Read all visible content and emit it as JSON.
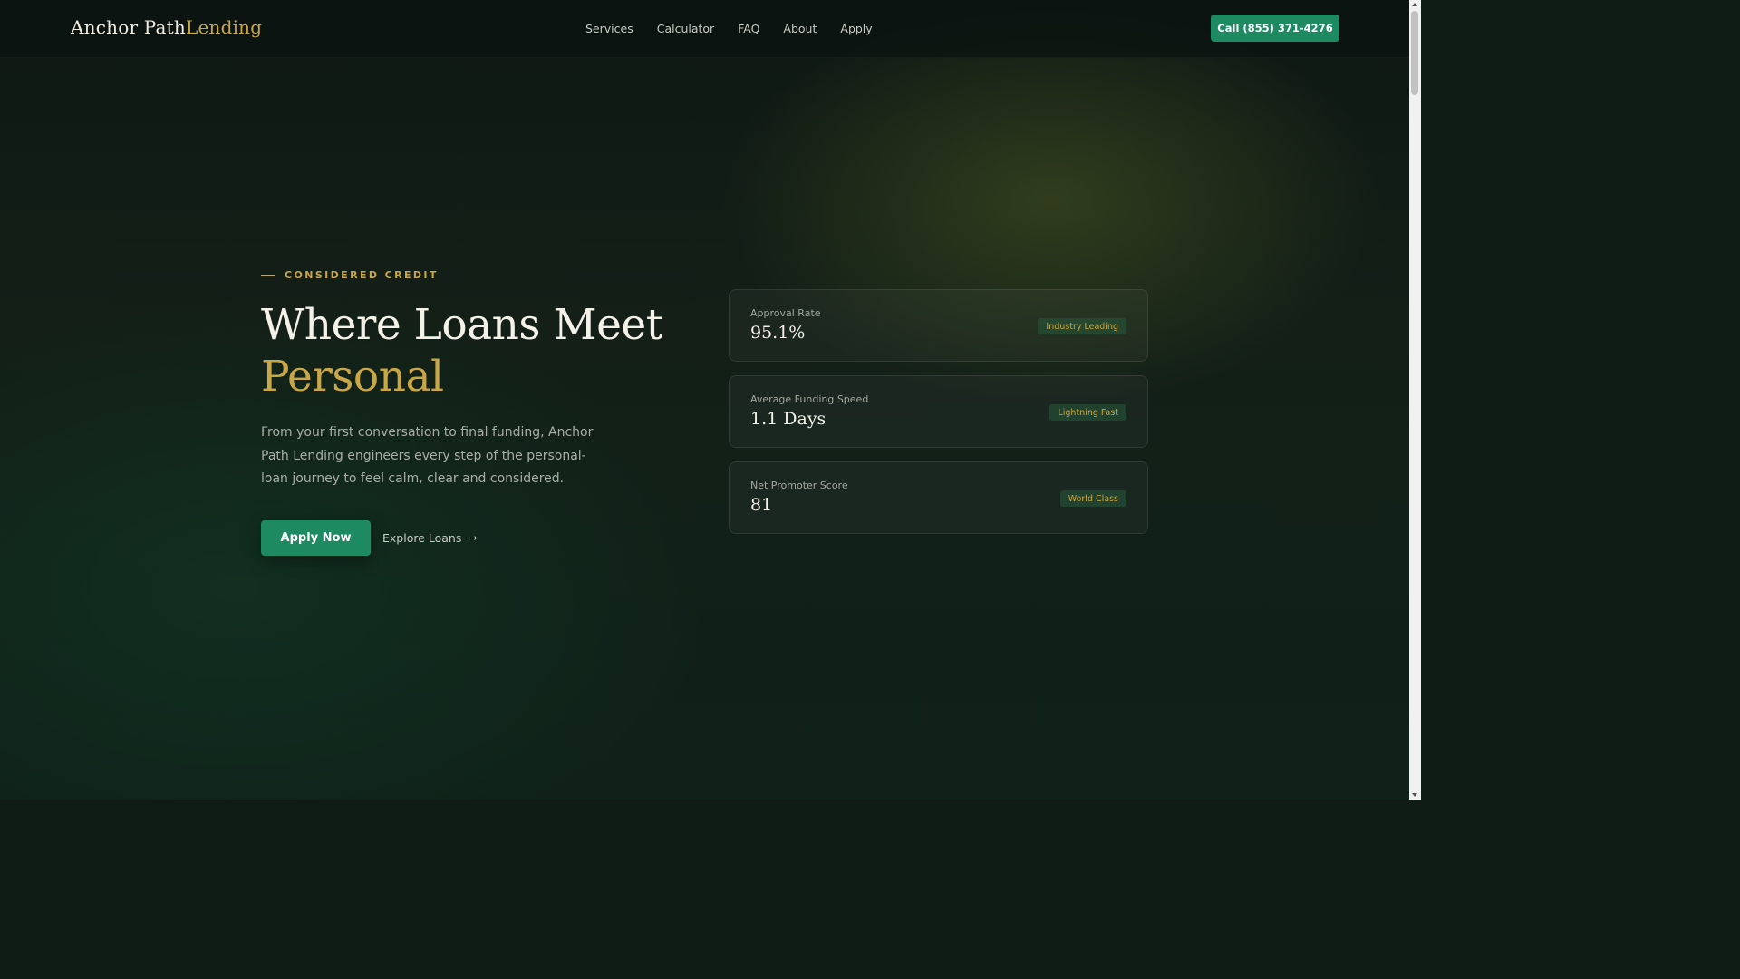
{
  "header": {
    "logo_part1": "Anchor Path",
    "logo_part2": "Lending",
    "nav": [
      "Services",
      "Calculator",
      "FAQ",
      "About",
      "Apply"
    ],
    "call_label": "Call (855) 371-4276"
  },
  "hero": {
    "eyebrow": "CONSIDERED CREDIT",
    "title_line1": "Where Loans Meet",
    "title_line2": "Personal",
    "description": "From your first conversation to final funding, Anchor Path Lending engineers every step of the personal-loan journey to feel calm, clear and considered.",
    "primary_cta": "Apply Now",
    "secondary_cta": "Explore Loans",
    "secondary_arrow": "→"
  },
  "stats": [
    {
      "label": "Approval Rate",
      "value": "95.1%",
      "badge": "Industry Leading"
    },
    {
      "label": "Average Funding Speed",
      "value": "1.1 Days",
      "badge": "Lightning Fast"
    },
    {
      "label": "Net Promoter Score",
      "value": "81",
      "badge": "World Class"
    }
  ],
  "colors": {
    "accent_gold": "#c9a646",
    "accent_green": "#1d8a62",
    "background": "#0f1c16"
  },
  "scrollbar": {
    "position_fraction": 0
  }
}
